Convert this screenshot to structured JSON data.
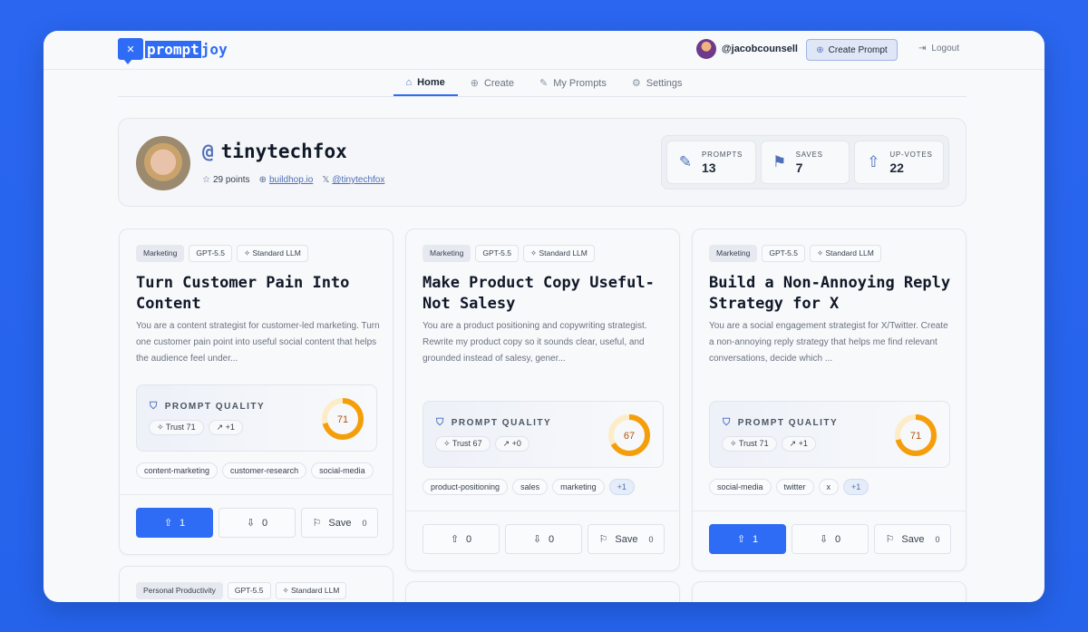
{
  "app": {
    "logo_mark": "✕",
    "logo_part1": "prompt",
    "logo_part2": "joy"
  },
  "header": {
    "username": "@jacobcounsell",
    "create_label": "Create Prompt",
    "logout_label": "Logout"
  },
  "nav": {
    "items": [
      {
        "label": "Home",
        "icon": "⌂"
      },
      {
        "label": "Create",
        "icon": "⊕"
      },
      {
        "label": "My Prompts",
        "icon": "✎"
      },
      {
        "label": "Settings",
        "icon": "⚙"
      }
    ]
  },
  "profile": {
    "at": "@",
    "name": "tinytechfox",
    "points": "29 points",
    "website": "buildhop.io",
    "x_handle": "@tinytechfox",
    "stats": [
      {
        "label": "PROMPTS",
        "value": "13",
        "icon": "✎"
      },
      {
        "label": "SAVES",
        "value": "7",
        "icon": "⚑"
      },
      {
        "label": "UP-VOTES",
        "value": "22",
        "icon": "⇧"
      }
    ]
  },
  "quality_label": "PROMPT QUALITY",
  "save_label": "Save",
  "cards": [
    {
      "category": "Marketing",
      "model": "GPT-5.5",
      "type": "Standard LLM",
      "title": "Turn Customer Pain Into Content",
      "description": "You are a content strategist for customer-led marketing. Turn one customer pain point into useful social content that helps the audience feel under...",
      "trust": "Trust 71",
      "delta": "+1",
      "score": 71,
      "keywords": [
        "content-marketing",
        "customer-research",
        "social-media"
      ],
      "upvotes": "1",
      "downvotes": "0",
      "saves": "0",
      "upvoted": true
    },
    {
      "category": "Marketing",
      "model": "GPT-5.5",
      "type": "Standard LLM",
      "title": "Make Product Copy Useful-Not Salesy",
      "description": "You are a product positioning and copywriting strategist. Rewrite my product copy so it sounds clear, useful, and grounded instead of salesy, gener...",
      "trust": "Trust 67",
      "delta": "+0",
      "score": 67,
      "keywords": [
        "product-positioning",
        "sales",
        "marketing",
        "+1"
      ],
      "upvotes": "0",
      "downvotes": "0",
      "saves": "0",
      "upvoted": false
    },
    {
      "category": "Marketing",
      "model": "GPT-5.5",
      "type": "Standard LLM",
      "title": "Build a Non-Annoying Reply Strategy for X",
      "description": "You are a social engagement strategist for X/Twitter. Create a non-annoying reply strategy that helps me find relevant conversations, decide which ...",
      "trust": "Trust 71",
      "delta": "+1",
      "score": 71,
      "keywords": [
        "social-media",
        "twitter",
        "x",
        "+1"
      ],
      "upvotes": "1",
      "downvotes": "0",
      "saves": "0",
      "upvoted": true
    },
    {
      "category": "Personal Productivity",
      "model": "GPT-5.5",
      "type": "Standard LLM"
    }
  ],
  "colors": {
    "accent": "#2f6cf5",
    "donut": "#f59e0b",
    "donut_track": "#fdecc8",
    "score_text": "#b45309"
  }
}
